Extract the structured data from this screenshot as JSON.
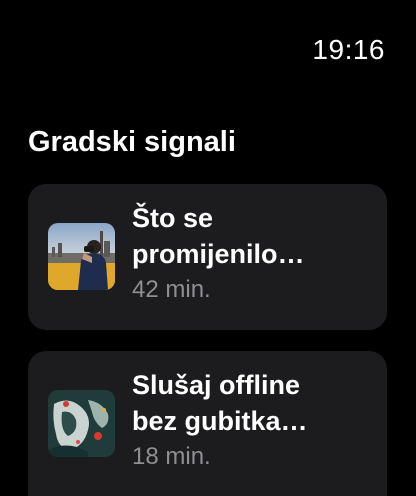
{
  "status_bar": {
    "time": "19:16"
  },
  "section": {
    "title": "Gradski signali"
  },
  "episodes": [
    {
      "title": "Što se\npromijenilo…",
      "duration": "42 min.",
      "artwork_icon": "city-photographer-artwork"
    },
    {
      "title": "Slušaj offline\nbez gubitka…",
      "duration": "18 min.",
      "artwork_icon": "abstract-map-artwork"
    }
  ]
}
